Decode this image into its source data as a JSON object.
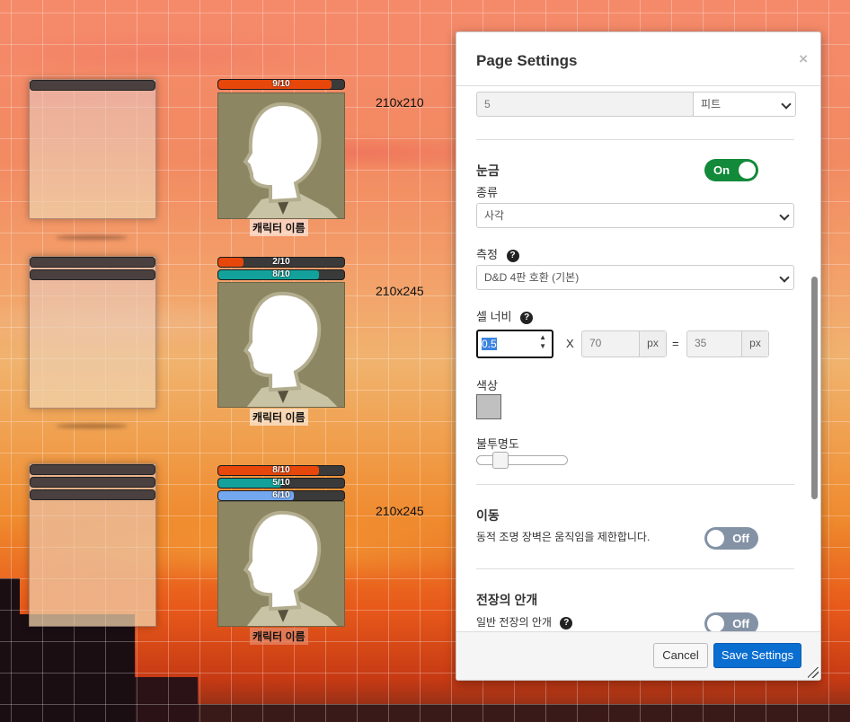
{
  "canvas": {
    "size_labels": [
      "210x210",
      "210x245",
      "210x245"
    ],
    "tokens": [
      {
        "bars": [
          {
            "label": "9/10",
            "fraction": 0.9,
            "color": "#e8470c"
          }
        ],
        "name": "캐릭터 이름"
      },
      {
        "bars": [
          {
            "label": "2/10",
            "fraction": 0.2,
            "color": "#e8470c"
          },
          {
            "label": "8/10",
            "fraction": 0.8,
            "color": "#13a29b"
          }
        ],
        "name": "캐릭터 이름"
      },
      {
        "bars": [
          {
            "label": "8/10",
            "fraction": 0.8,
            "color": "#e8470c"
          },
          {
            "label": "5/10",
            "fraction": 0.5,
            "color": "#13a29b"
          },
          {
            "label": "6/10",
            "fraction": 0.6,
            "color": "#73a7f0"
          }
        ],
        "name": "캐릭터 이름"
      }
    ]
  },
  "dialog": {
    "title": "Page Settings",
    "close_icon": "×",
    "scale": {
      "value": "5",
      "unit": "피트"
    },
    "grid": {
      "title": "눈금",
      "toggle": "On",
      "type_label": "종류",
      "type_value": "사각",
      "measure_label": "측정",
      "measure_value": "D&D 4판 호환 (기본)",
      "cell_width_label": "셀 너비",
      "cell_width_value": "0.5",
      "times": "X",
      "px_value": "70",
      "px_unit": "px",
      "equals": "=",
      "result_value": "35",
      "result_unit": "px",
      "color_label": "색상",
      "color_value": "#c0c0c0",
      "opacity_label": "불투명도",
      "opacity_value": 0.2
    },
    "movement": {
      "title": "이동",
      "description": "동적 조명 장벽은 움직임을 제한합니다.",
      "toggle": "Off"
    },
    "fog": {
      "title": "전장의 안개",
      "sub_label": "일반 전장의 안개",
      "toggle": "Off"
    },
    "footer": {
      "cancel": "Cancel",
      "save": "Save Settings"
    },
    "help_glyph": "?"
  }
}
